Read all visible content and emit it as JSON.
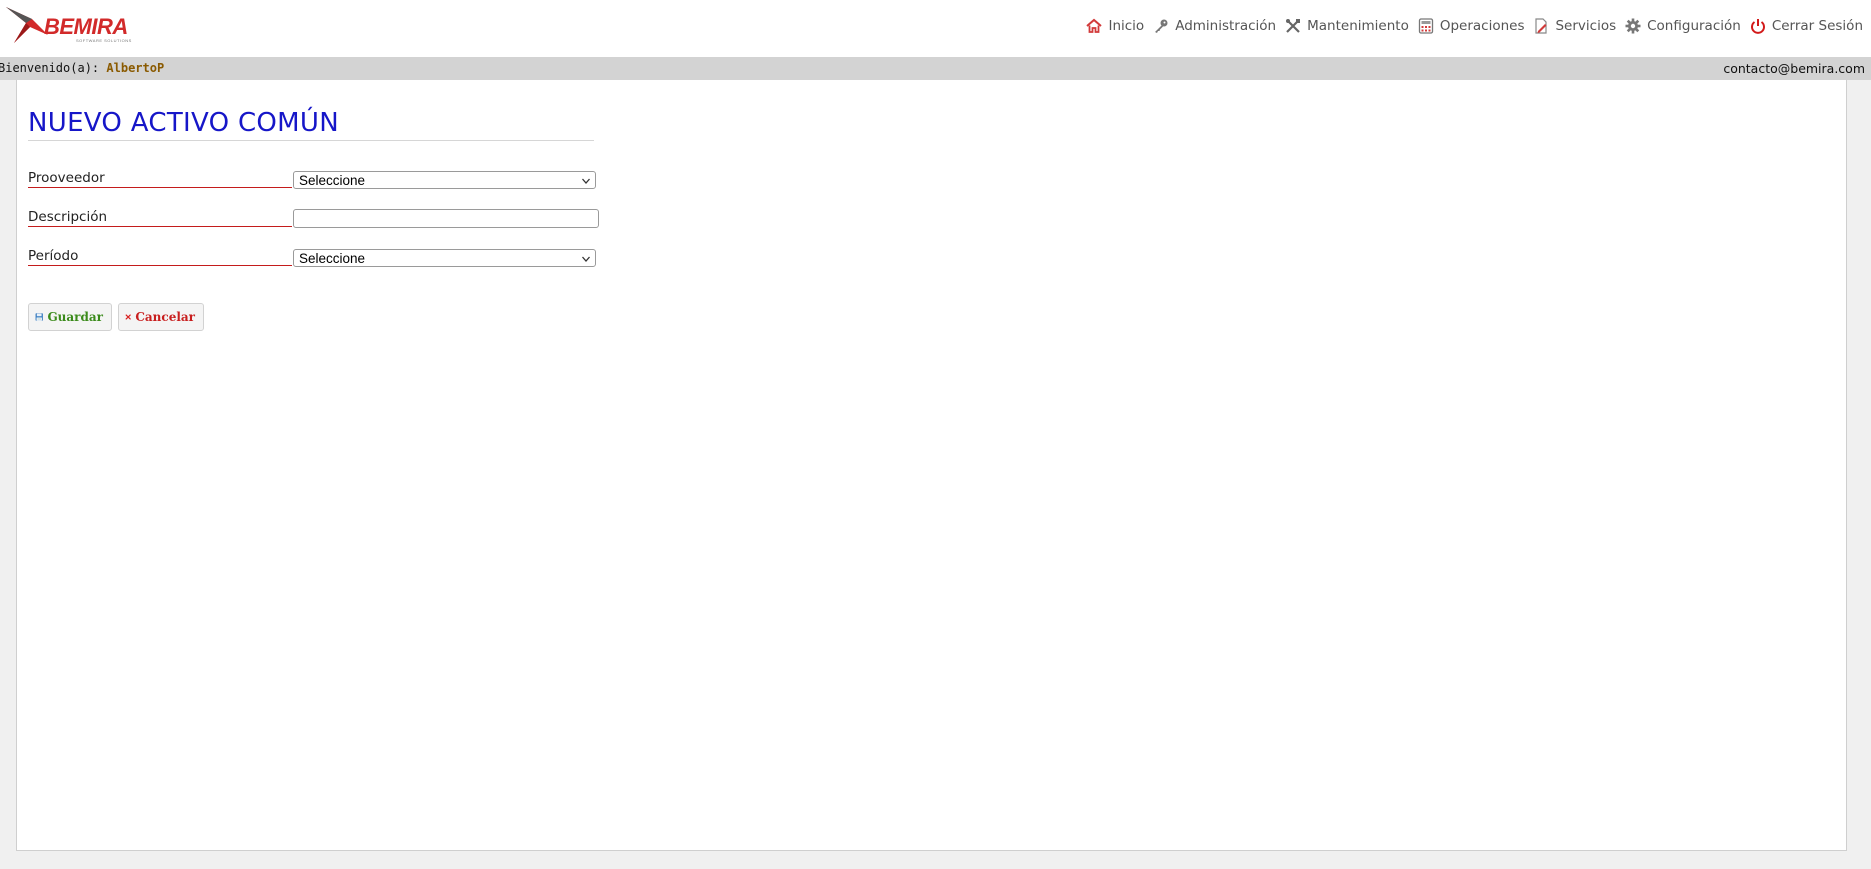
{
  "app": {
    "logo_text": "BEMIRA",
    "logo_tagline": "SOFTWARE SOLUTIONS"
  },
  "nav": {
    "items": [
      {
        "label": "Inicio",
        "icon": "home-icon"
      },
      {
        "label": "Administración",
        "icon": "key-icon"
      },
      {
        "label": "Mantenimiento",
        "icon": "tools-icon"
      },
      {
        "label": "Operaciones",
        "icon": "calculator-icon"
      },
      {
        "label": "Servicios",
        "icon": "edit-document-icon"
      },
      {
        "label": "Configuración",
        "icon": "gear-icon"
      },
      {
        "label": "Cerrar Sesión",
        "icon": "power-icon"
      }
    ]
  },
  "welcome": {
    "prefix": "Bienvenido(a):",
    "username": "AlbertoP",
    "contact": "contacto@bemira.com"
  },
  "page": {
    "title": "NUEVO ACTIVO COMÚN"
  },
  "form": {
    "proveedor": {
      "label": "Prooveedor",
      "value": "Seleccione"
    },
    "descripcion": {
      "label": "Descripción",
      "value": ""
    },
    "periodo": {
      "label": "Período",
      "value": "Seleccione"
    }
  },
  "actions": {
    "save_label": "Guardar",
    "cancel_label": "Cancelar"
  },
  "colors": {
    "title": "#1616c8",
    "label_underline": "#c41c1c",
    "save_text": "#3a8a1a",
    "cancel_text": "#c81e1e",
    "welcome_bar": "#d3d3d3",
    "username": "#8a5a00"
  }
}
